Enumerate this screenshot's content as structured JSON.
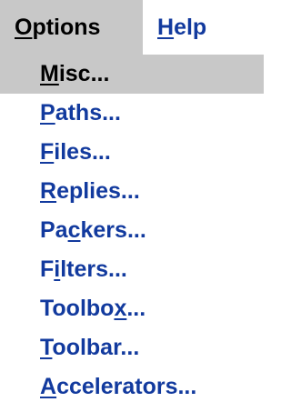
{
  "menubar": {
    "items": [
      {
        "pre": "",
        "acc": "O",
        "post": "ptions",
        "state": "active"
      },
      {
        "pre": "",
        "acc": "H",
        "post": "elp",
        "state": "normal"
      }
    ]
  },
  "menu": {
    "items": [
      {
        "pre": "",
        "acc": "M",
        "post": "isc...",
        "state": "selected"
      },
      {
        "pre": "",
        "acc": "P",
        "post": "aths...",
        "state": "normal"
      },
      {
        "pre": "",
        "acc": "F",
        "post": "iles...",
        "state": "normal"
      },
      {
        "pre": "",
        "acc": "R",
        "post": "eplies...",
        "state": "normal"
      },
      {
        "pre": "Pa",
        "acc": "c",
        "post": "kers...",
        "state": "normal"
      },
      {
        "pre": "F",
        "acc": "i",
        "post": "lters...",
        "state": "normal"
      },
      {
        "pre": "Toolbo",
        "acc": "x",
        "post": "...",
        "state": "normal"
      },
      {
        "pre": "",
        "acc": "T",
        "post": "oolbar...",
        "state": "normal"
      },
      {
        "pre": "",
        "acc": "A",
        "post": "ccelerators...",
        "state": "normal"
      }
    ]
  },
  "colors": {
    "menu_text": "#123a9e",
    "highlight_bg": "#c8c8c8",
    "highlight_text": "#000000",
    "background": "#ffffff"
  }
}
